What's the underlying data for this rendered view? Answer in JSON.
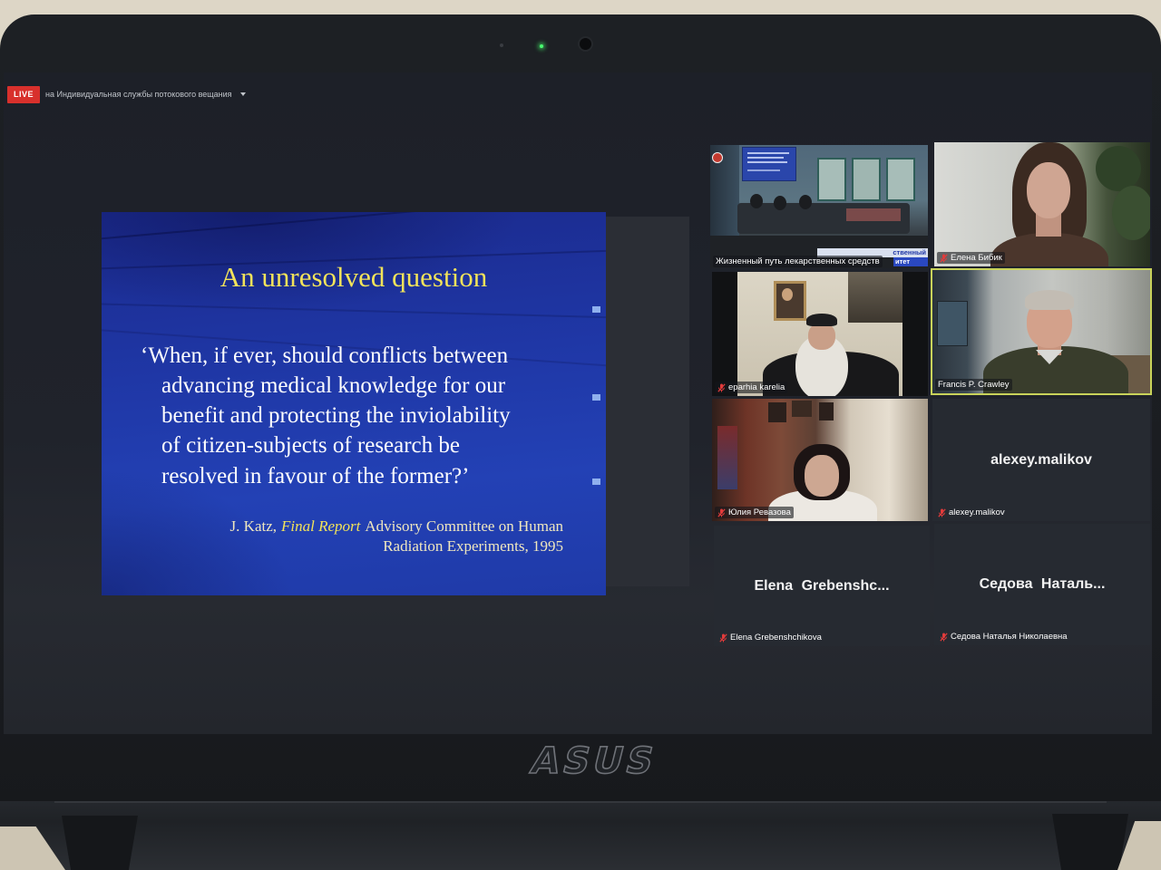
{
  "window": {
    "live_badge": "LIVE",
    "stream_title": "на Индивидуальная службы потокового вещания",
    "dropdown_icon": "chevron-down-icon"
  },
  "slide": {
    "title": "An unresolved question",
    "quote_lines": [
      "‘When, if ever, should conflicts between",
      "advancing medical knowledge for our",
      "benefit and protecting the inviolability",
      "of citizen-subjects of research be",
      "resolved in favour of the former?’"
    ],
    "citation": {
      "author": "J. Katz,",
      "work": "Final Report",
      "line1_rest": "Advisory Committee on Human",
      "line2": "Radiation Experiments, 1995"
    }
  },
  "participants": [
    {
      "name": "Жизненный путь лекарственных средств",
      "muted": false,
      "video": true,
      "overlay_text": [
        "ственный",
        "итет"
      ]
    },
    {
      "name": "Елена Бибик",
      "muted": true,
      "video": true
    },
    {
      "name": "eparhia karelia",
      "muted": true,
      "video": true
    },
    {
      "name": "Francis P. Crawley",
      "muted": false,
      "video": true,
      "active_speaker": true
    },
    {
      "name": "Юлия Ревазова",
      "muted": true,
      "video": true
    },
    {
      "name": "alexey.malikov",
      "display_name": "alexey.malikov",
      "muted": true,
      "video": false
    },
    {
      "name": "Elena Grebenshchikova",
      "display_name": "Elena Grebenshc...",
      "muted": true,
      "video": false
    },
    {
      "name": "Седова Наталья Николаевна",
      "display_name": "Седова Наталь...",
      "muted": true,
      "video": false
    }
  ],
  "icons": {
    "muted": "muted-mic-icon",
    "dropdown": "chevron-down-icon",
    "webcam": "webcam-icon"
  },
  "laptop": {
    "brand": "ASUS"
  },
  "colors": {
    "live_badge": "#d8302c",
    "slide_background": "#2039a8",
    "slide_title": "#f2e35a",
    "slide_text": "#ffffff",
    "active_speaker_border": "#c9d35a",
    "muted_icon": "#e23b3b",
    "tile_background": "#262a31"
  }
}
